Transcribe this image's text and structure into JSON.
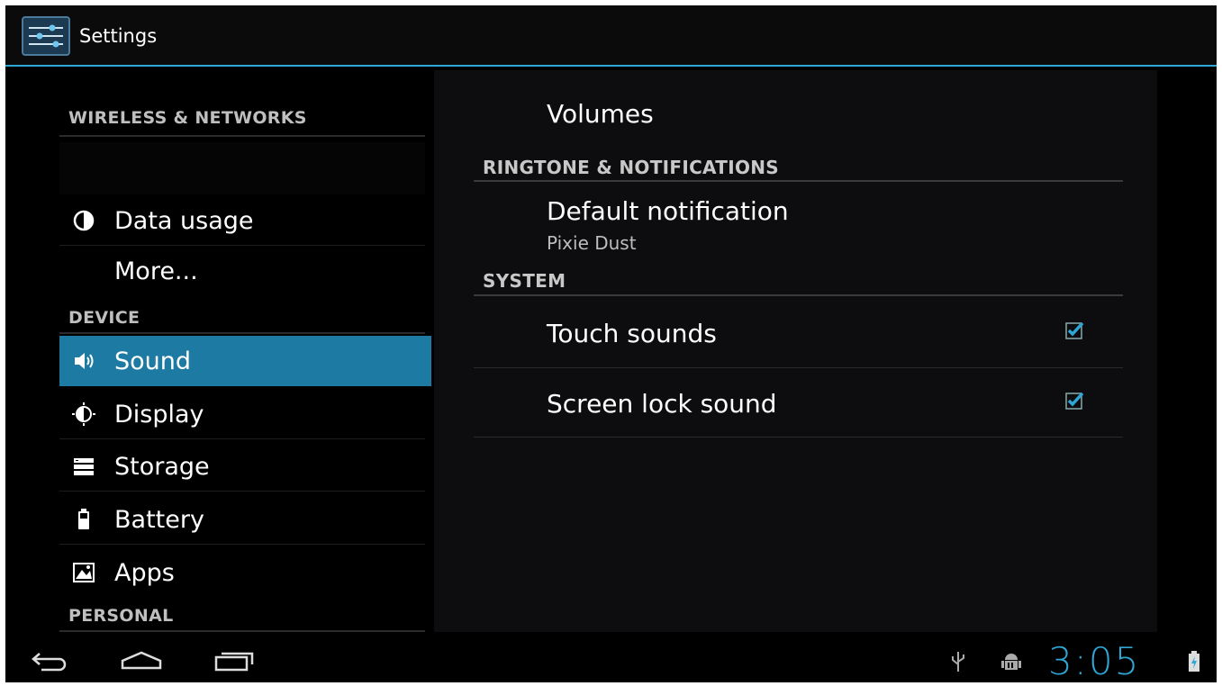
{
  "app": {
    "title": "Settings",
    "icon": "settings-sliders-icon"
  },
  "sidebar": {
    "headers": {
      "wireless": "WIRELESS & NETWORKS",
      "device": "DEVICE",
      "personal": "PERSONAL"
    },
    "items": [
      {
        "label": "Data usage",
        "icon": "data-usage-icon"
      },
      {
        "label": "More...",
        "icon": ""
      },
      {
        "label": "Sound",
        "icon": "sound-icon",
        "selected": true
      },
      {
        "label": "Display",
        "icon": "display-icon"
      },
      {
        "label": "Storage",
        "icon": "storage-icon"
      },
      {
        "label": "Battery",
        "icon": "battery-icon"
      },
      {
        "label": "Apps",
        "icon": "apps-icon"
      }
    ]
  },
  "detail": {
    "volumes": "Volumes",
    "ringtone_header": "RINGTONE & NOTIFICATIONS",
    "default_notification": {
      "title": "Default notification",
      "summary": "Pixie Dust"
    },
    "system_header": "SYSTEM",
    "touch_sounds": {
      "label": "Touch sounds",
      "checked": true
    },
    "screen_lock_sound": {
      "label": "Screen lock sound",
      "checked": true
    }
  },
  "system_bar": {
    "clock": "3:05",
    "accent": "#2fa7d6",
    "icons": [
      "back-icon",
      "home-icon",
      "recent-apps-icon",
      "usb-icon",
      "android-debug-icon",
      "battery-charging-icon"
    ]
  }
}
